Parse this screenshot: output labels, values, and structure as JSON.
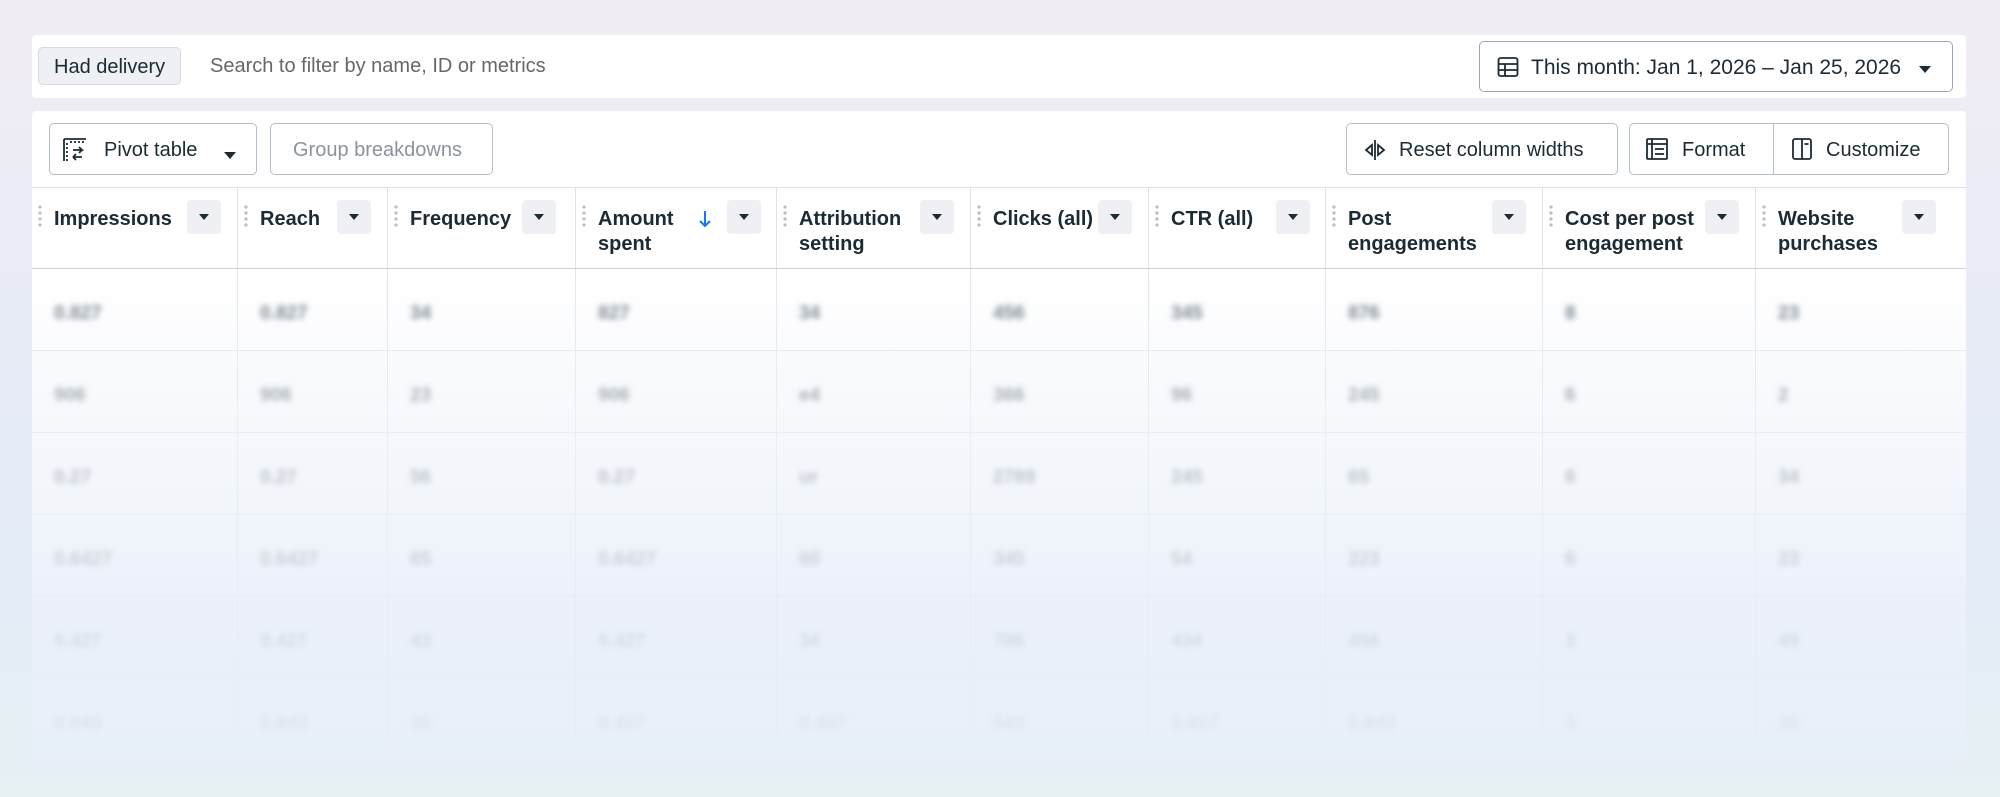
{
  "filter_bar": {
    "chip_label": "Had delivery",
    "search_placeholder": "Search to filter by name, ID or metrics",
    "date_range_label": "This month: Jan 1, 2026 – Jan 25, 2026"
  },
  "toolbar": {
    "pivot_label": "Pivot table",
    "group_label": "Group breakdowns",
    "reset_label": "Reset column widths",
    "format_label": "Format",
    "customize_label": "Customize"
  },
  "columns": [
    {
      "line1": "Impressions",
      "line2": ""
    },
    {
      "line1": "Reach",
      "line2": ""
    },
    {
      "line1": "Frequency",
      "line2": ""
    },
    {
      "line1": "Amount",
      "line2": "spent",
      "sorted": "descending"
    },
    {
      "line1": "Attribution",
      "line2": "setting"
    },
    {
      "line1": "Clicks (all)",
      "line2": ""
    },
    {
      "line1": "CTR (all)",
      "line2": ""
    },
    {
      "line1": "Post",
      "line2": "engagements"
    },
    {
      "line1": "Cost per post",
      "line2": "engagement"
    },
    {
      "line1": "Website",
      "line2": "purchases"
    }
  ],
  "rows": [
    [
      "0.827",
      "0.827",
      "34",
      "827",
      "34",
      "456",
      "345",
      "876",
      "8",
      "23"
    ],
    [
      "906",
      "906",
      "23",
      "906",
      "e4",
      "366",
      "96",
      "245",
      "6",
      "2"
    ],
    [
      "0.27",
      "0.27",
      "56",
      "0.27",
      "ur",
      "2789",
      "245",
      "65",
      "6",
      "34"
    ],
    [
      "0.6427",
      "0.6427",
      "65",
      "0.6427",
      "60",
      "345",
      "54",
      "223",
      "6",
      "23"
    ],
    [
      "0.427",
      "0.427",
      "43",
      "0.427",
      "34",
      "786",
      "434",
      "456",
      "3",
      "45"
    ],
    [
      "0.643",
      "0.643",
      "32",
      "0.427",
      "0.427",
      "543",
      "0.427",
      "0.643",
      "3",
      "32"
    ]
  ]
}
